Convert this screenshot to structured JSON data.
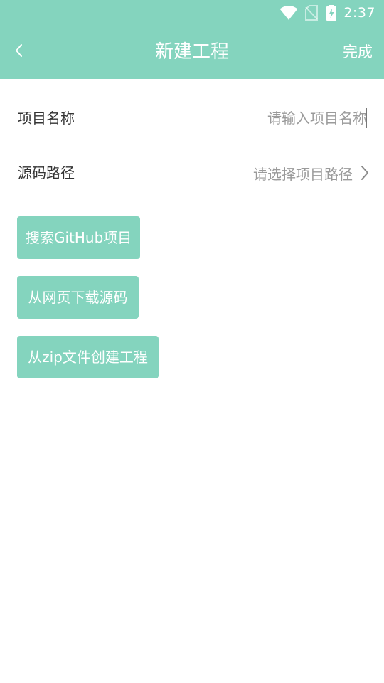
{
  "status_bar": {
    "time": "2:37",
    "icons": [
      "wifi-icon",
      "no-sim-icon",
      "battery-charging-icon"
    ]
  },
  "app_bar": {
    "title": "新建工程",
    "back_icon": "chevron-left-icon",
    "done_label": "完成"
  },
  "form": {
    "name_label": "项目名称",
    "name_value": "",
    "name_placeholder": "请输入项目名称",
    "path_label": "源码路径",
    "path_placeholder": "请选择项目路径",
    "path_icon": "chevron-right-icon"
  },
  "actions": {
    "search_github": "搜索GitHub项目",
    "download_web": "从网页下载源码",
    "create_from_zip": "从zip文件创建工程"
  },
  "colors": {
    "accent": "#84d4be",
    "text_primary": "#333333",
    "text_hint": "#9a9a9a",
    "background": "#ffffff"
  }
}
